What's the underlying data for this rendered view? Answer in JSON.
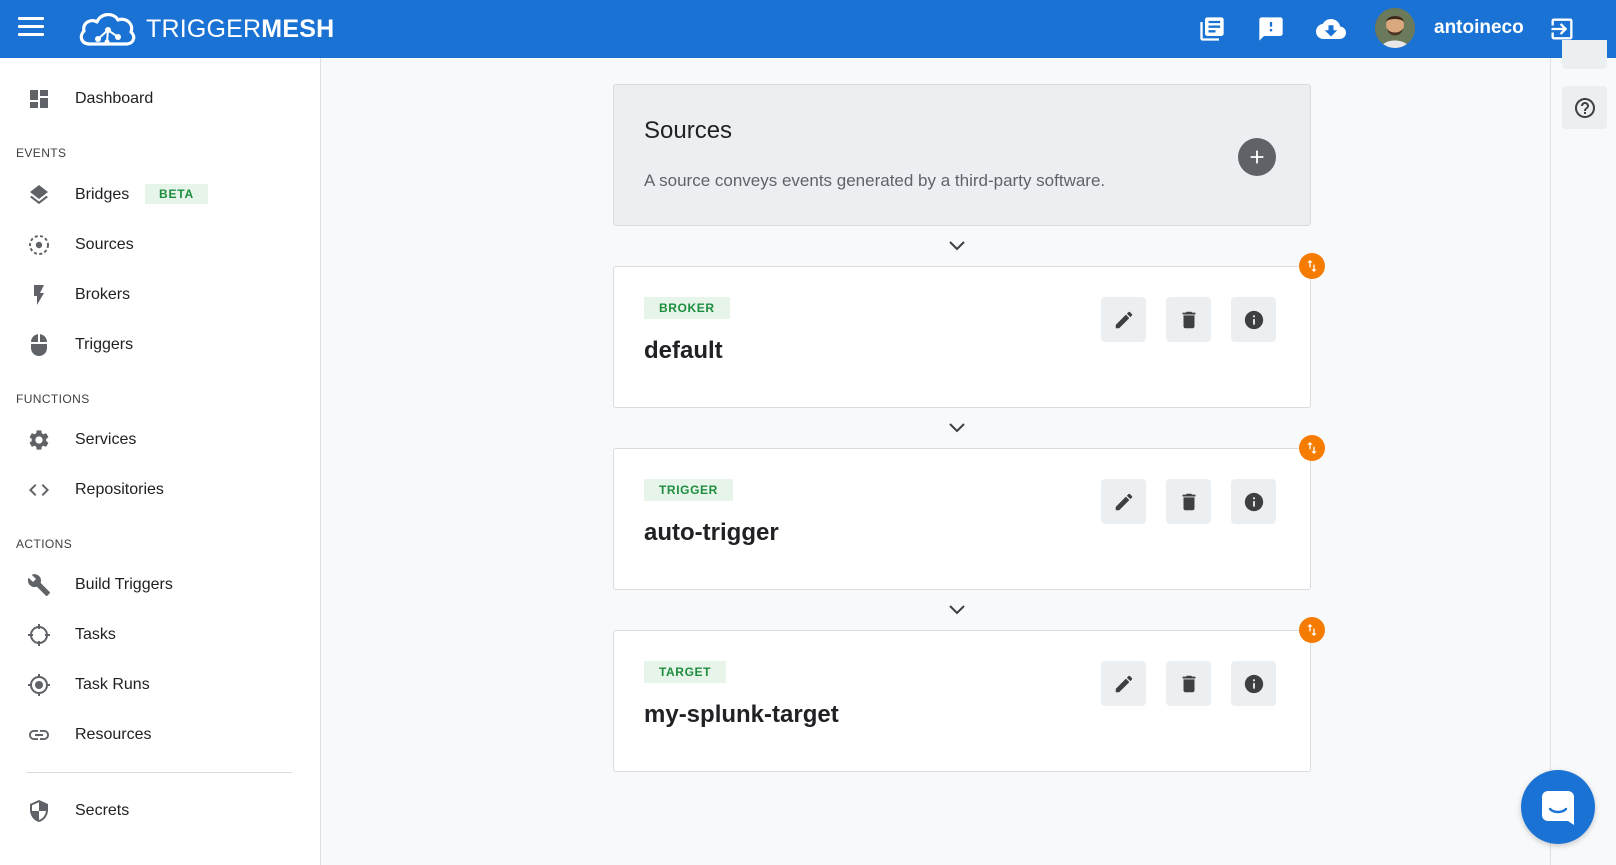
{
  "header": {
    "logo_part1": "TRIGGER",
    "logo_part2": "MESH",
    "username": "antoineco",
    "icons": [
      "menu-icon",
      "docs-icon",
      "feedback-icon",
      "download-icon",
      "logout-icon"
    ]
  },
  "sidebar": {
    "dashboard": "Dashboard",
    "events_section": "EVENTS",
    "bridges": "Bridges",
    "beta": "BETA",
    "sources": "Sources",
    "brokers": "Brokers",
    "triggers": "Triggers",
    "functions_section": "FUNCTIONS",
    "services": "Services",
    "repositories": "Repositories",
    "actions_section": "ACTIONS",
    "build_triggers": "Build Triggers",
    "tasks": "Tasks",
    "task_runs": "Task Runs",
    "resources": "Resources",
    "secrets": "Secrets"
  },
  "main": {
    "sources_title": "Sources",
    "sources_desc": "A source conveys events generated by a third-party software.",
    "items": [
      {
        "type": "BROKER",
        "name": "default"
      },
      {
        "type": "TRIGGER",
        "name": "auto-trigger"
      },
      {
        "type": "TARGET",
        "name": "my-splunk-target"
      }
    ]
  },
  "colors": {
    "primary": "#1a73d4",
    "badge_bg": "#e6f4ea",
    "badge_text": "#1e8e3e",
    "swap_orange": "#f57c00"
  }
}
